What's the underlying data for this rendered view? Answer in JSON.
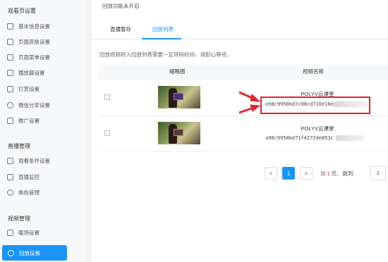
{
  "sidebar": {
    "sections": [
      {
        "title": "观看页设置",
        "items": [
          {
            "label": "基本信息设置",
            "icon": "document-icon"
          },
          {
            "label": "页面皮肤设置",
            "icon": "skin-icon"
          },
          {
            "label": "页面菜单设置",
            "icon": "menu-icon"
          },
          {
            "label": "播放器设置",
            "icon": "player-icon"
          },
          {
            "label": "打赏设置",
            "icon": "reward-icon"
          },
          {
            "label": "微信分享设置",
            "icon": "wechat-icon"
          },
          {
            "label": "推广设置",
            "icon": "megaphone-icon"
          }
        ]
      },
      {
        "title": "直播管理",
        "items": [
          {
            "label": "观看条件设置",
            "icon": "key-icon"
          },
          {
            "label": "直播监控",
            "icon": "chart-icon"
          },
          {
            "label": "角色管理",
            "icon": "user-icon"
          }
        ]
      },
      {
        "title": "视频管理",
        "items": [
          {
            "label": "暖场设置",
            "icon": "edit-icon"
          },
          {
            "label": "回放设置",
            "icon": "replay-icon",
            "active": true
          }
        ]
      }
    ]
  },
  "main": {
    "top_note": "回放功能未开启",
    "tabs": [
      {
        "label": "直播暂存"
      },
      {
        "label": "回放列表",
        "active": true
      }
    ],
    "hint": "回放视频转入回放列表需要一定转码时间，请耐心等待。",
    "table": {
      "columns": [
        "缩略图",
        "视频名称"
      ],
      "rows": [
        {
          "name": "POLYV云课堂",
          "id": "a98c9950bd7c08cd710e10e"
        },
        {
          "name": "POLYV云课堂",
          "id": "a98c9950bd71f4272de853c"
        }
      ]
    },
    "pagination": {
      "prev": "<",
      "current": "1",
      "next": ">",
      "total_prefix": "共",
      "total_pages": "1",
      "total_suffix": "页,",
      "jump_label": "跳到:",
      "jump_value": "1"
    }
  },
  "colors": {
    "accent": "#1b94f6",
    "highlight": "#e0262c"
  }
}
